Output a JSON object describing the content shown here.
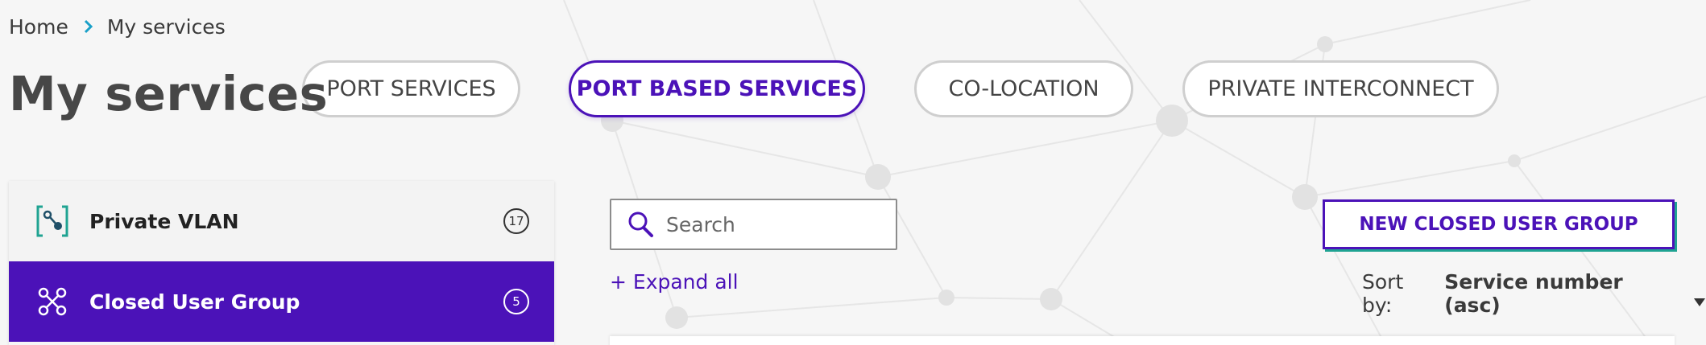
{
  "breadcrumb": {
    "home": "Home",
    "current": "My services"
  },
  "page_title": "My services",
  "tabs": [
    {
      "label": "PORT SERVICES",
      "active": false
    },
    {
      "label": "PORT BASED SERVICES",
      "active": true
    },
    {
      "label": "CO-LOCATION",
      "active": false
    },
    {
      "label": "PRIVATE INTERCONNECT",
      "active": false
    }
  ],
  "sidebar": {
    "items": [
      {
        "label": "Private VLAN",
        "count": "17",
        "icon": "vlan-icon",
        "active": false
      },
      {
        "label": "Closed User Group",
        "count": "5",
        "icon": "network-group-icon",
        "active": true
      }
    ]
  },
  "search": {
    "placeholder": "Search",
    "value": ""
  },
  "expand_all": "+ Expand all",
  "new_button": "NEW CLOSED USER GROUP",
  "sort": {
    "label": "Sort by:",
    "value": "Service number (asc)"
  },
  "colors": {
    "accent": "#4b12b8",
    "teal": "#1fa392",
    "background": "#f6f6f6"
  }
}
